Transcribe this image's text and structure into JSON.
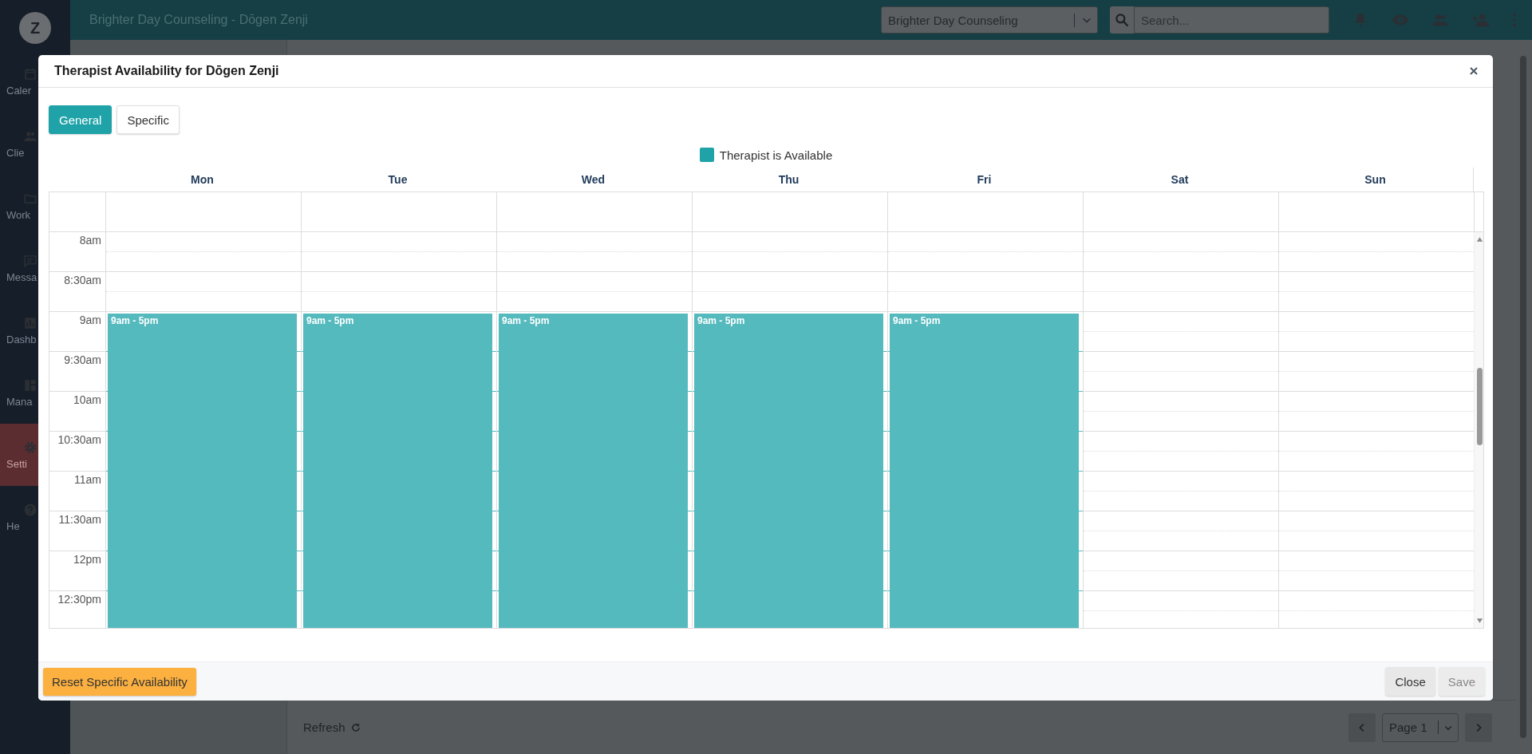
{
  "app_bar": {
    "title": "Brighter Day Counseling - Dōgen Zenji",
    "practice_select": {
      "value": "Brighter Day Counseling"
    },
    "search": {
      "placeholder": "Search..."
    }
  },
  "sidebar": {
    "avatar": "Z",
    "items": [
      {
        "label": "Caler",
        "selected": false
      },
      {
        "label": "Clie",
        "selected": false
      },
      {
        "label": "Work",
        "selected": false
      },
      {
        "label": "Messa",
        "selected": false
      },
      {
        "label": "Dashb",
        "selected": false
      },
      {
        "label": "Mana",
        "selected": false
      },
      {
        "label": "Setti",
        "selected": true
      },
      {
        "label": "He",
        "selected": false
      }
    ]
  },
  "background": {
    "refresh": "Refresh",
    "page_select": "Page 1"
  },
  "modal": {
    "title": "Therapist Availability for Dōgen Zenji",
    "tabs": [
      {
        "label": "General",
        "selected": true
      },
      {
        "label": "Specific",
        "selected": false
      }
    ],
    "legend": "Therapist is Available",
    "days": [
      {
        "name": "Mon",
        "block": "9am - 5pm"
      },
      {
        "name": "Tue",
        "block": "9am - 5pm"
      },
      {
        "name": "Wed",
        "block": "9am - 5pm"
      },
      {
        "name": "Thu",
        "block": "9am - 5pm"
      },
      {
        "name": "Fri",
        "block": "9am - 5pm"
      },
      {
        "name": "Sat"
      },
      {
        "name": "Sun"
      }
    ],
    "slots": [
      {
        "time": "8am",
        "available": [
          false,
          false,
          false,
          false,
          false,
          false,
          false
        ]
      },
      {
        "time": "8:30am",
        "available": [
          false,
          false,
          false,
          false,
          false,
          false,
          false
        ]
      },
      {
        "time": "9am",
        "available": [
          true,
          true,
          true,
          true,
          true,
          false,
          false
        ]
      },
      {
        "time": "9:30am",
        "available": [
          true,
          true,
          true,
          true,
          true,
          false,
          false
        ]
      },
      {
        "time": "10am",
        "available": [
          true,
          true,
          true,
          true,
          true,
          false,
          false
        ]
      },
      {
        "time": "10:30am",
        "available": [
          true,
          true,
          true,
          true,
          true,
          false,
          false
        ]
      },
      {
        "time": "11am",
        "available": [
          true,
          true,
          true,
          true,
          true,
          false,
          false
        ]
      },
      {
        "time": "11:30am",
        "available": [
          true,
          true,
          true,
          true,
          true,
          false,
          false
        ]
      },
      {
        "time": "12pm",
        "available": [
          true,
          true,
          true,
          true,
          true,
          false,
          false
        ]
      },
      {
        "time": "12:30pm",
        "available": [
          true,
          true,
          true,
          true,
          true,
          false,
          false
        ]
      }
    ],
    "reset_button": "Reset Specific Availability",
    "close_button": "Close",
    "save_button": {
      "label": "Save",
      "disabled": true
    }
  }
}
